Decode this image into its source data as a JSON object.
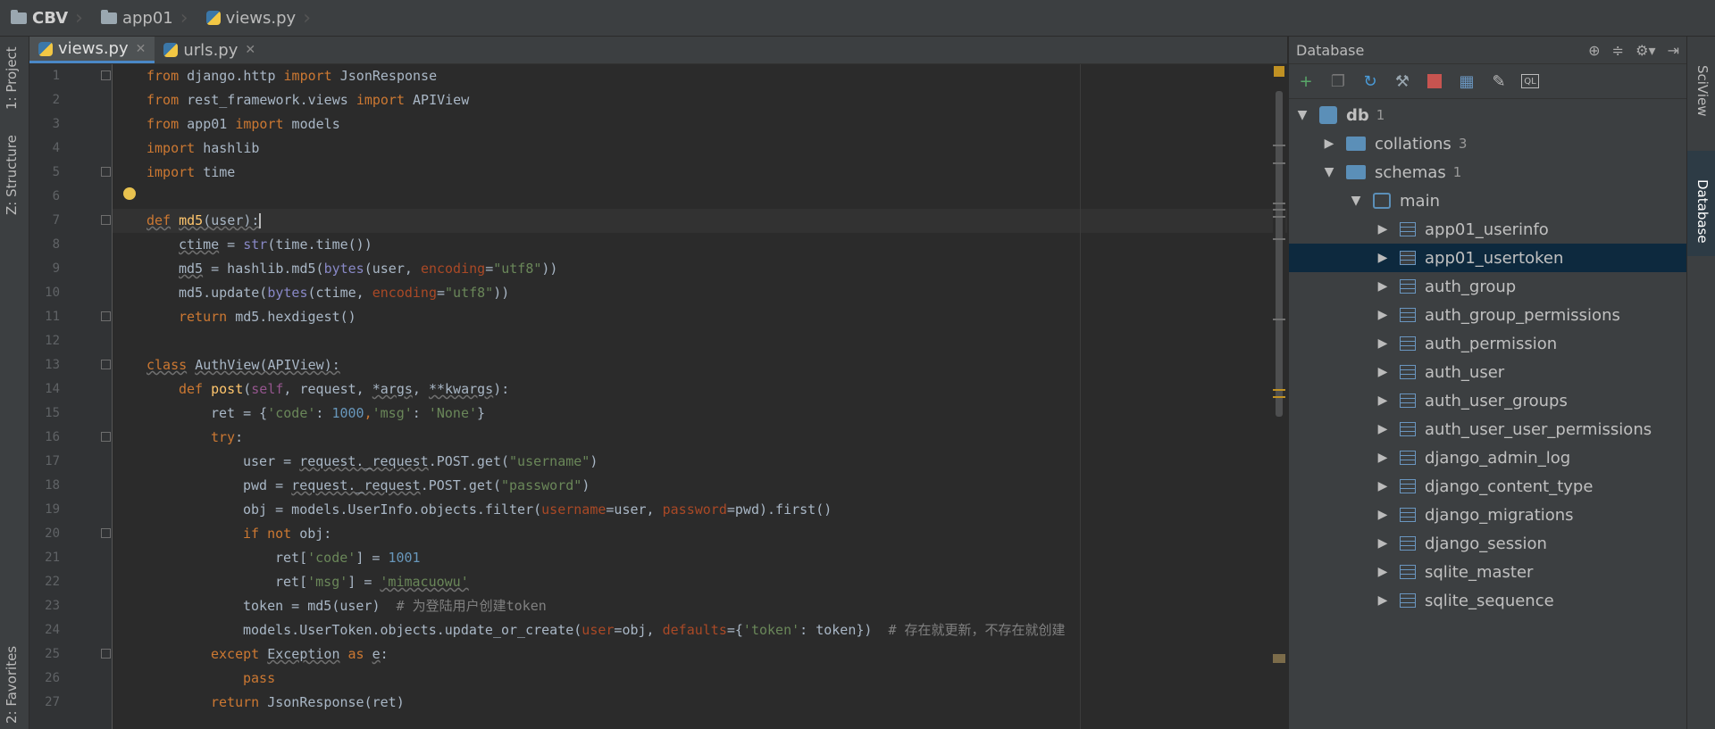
{
  "breadcrumb": {
    "items": [
      "CBV",
      "app01",
      "views.py"
    ]
  },
  "left_tool_tabs": [
    "1: Project",
    "Z: Structure",
    "2: Favorites"
  ],
  "right_tool_tabs": [
    "SciView",
    "Database"
  ],
  "editor_tabs": [
    {
      "label": "views.py",
      "active": true
    },
    {
      "label": "urls.py",
      "active": false
    }
  ],
  "line_numbers": [
    "1",
    "2",
    "3",
    "4",
    "5",
    "6",
    "7",
    "8",
    "9",
    "10",
    "11",
    "12",
    "13",
    "14",
    "15",
    "16",
    "17",
    "18",
    "19",
    "20",
    "21",
    "22",
    "23",
    "24",
    "25",
    "26",
    "27"
  ],
  "code": {
    "l1": [
      "from",
      " django.http ",
      "import",
      " JsonResponse"
    ],
    "l2": [
      "from",
      " rest_framework.views ",
      "import",
      " APIView"
    ],
    "l3": [
      "from",
      " app01 ",
      "import",
      " models"
    ],
    "l4": [
      "import",
      " hashlib"
    ],
    "l5": [
      "import",
      " time"
    ],
    "l7": [
      "def",
      " ",
      "md5",
      "(",
      "user",
      "):"
    ],
    "l8": [
      "ctime",
      " = ",
      "str",
      "(time.time())"
    ],
    "l9": [
      "md5",
      " = hashlib.md5(",
      "bytes",
      "(user, ",
      "encoding",
      "=",
      "\"utf8\"",
      "))"
    ],
    "l10": [
      "md5.update(",
      "bytes",
      "(ctime, ",
      "encoding",
      "=",
      "\"utf8\"",
      "))"
    ],
    "l11": [
      "return",
      " md5.hexdigest()"
    ],
    "l13": [
      "class",
      " ",
      "AuthView",
      "(",
      "APIView",
      "):"
    ],
    "l14": [
      "def",
      " ",
      "post",
      "(",
      "self",
      ", request, ",
      "*args",
      ", ",
      "**kwargs",
      "):"
    ],
    "l15": [
      "ret = {",
      "'code'",
      ": ",
      "1000",
      ",",
      "'msg'",
      ": ",
      "'None'",
      "}"
    ],
    "l16": [
      "try",
      ":"
    ],
    "l17": [
      "user = ",
      "request._request",
      ".POST.get(",
      "\"username\"",
      ")"
    ],
    "l18": [
      "pwd = ",
      "request._request",
      ".POST.get(",
      "\"password\"",
      ")"
    ],
    "l19": [
      "obj = models.UserInfo.objects.filter(",
      "username",
      "=user, ",
      "password",
      "=pwd).first()"
    ],
    "l20": [
      "if not",
      " obj:"
    ],
    "l21": [
      "ret[",
      "'code'",
      "] = ",
      "1001"
    ],
    "l22": [
      "ret[",
      "'msg'",
      "] = ",
      "'mimacuowu'"
    ],
    "l23": [
      "token = md5(user)  ",
      "# 为登陆用户创建token"
    ],
    "l24": [
      "models.UserToken.objects.update_or_create(",
      "user",
      "=obj, ",
      "defaults",
      "={",
      "'token'",
      ": token})  ",
      "# 存在就更新，不存在就创建"
    ],
    "l25": [
      "except",
      " ",
      "Exception",
      " ",
      "as",
      " ",
      "e",
      ":"
    ],
    "l26": [
      "pass"
    ],
    "l27": [
      "return",
      " JsonResponse(ret)"
    ]
  },
  "database_panel": {
    "title": "Database",
    "toolbar_icons": [
      "add-icon",
      "copy-icon",
      "refresh-icon",
      "properties-icon",
      "stop-icon",
      "table-icon",
      "edit-icon",
      "console-icon"
    ],
    "db": {
      "name": "db",
      "count": "1"
    },
    "collations": {
      "name": "collations",
      "count": "3"
    },
    "schemas": {
      "name": "schemas",
      "count": "1"
    },
    "schema_main": "main",
    "tables": [
      "app01_userinfo",
      "app01_usertoken",
      "auth_group",
      "auth_group_permissions",
      "auth_permission",
      "auth_user",
      "auth_user_groups",
      "auth_user_user_permissions",
      "django_admin_log",
      "django_content_type",
      "django_migrations",
      "django_session",
      "sqlite_master",
      "sqlite_sequence"
    ],
    "selected_table": "app01_usertoken"
  },
  "colors": {
    "keyword": "#cc7832",
    "string": "#6a8759",
    "number": "#6897bb",
    "comment": "#808080",
    "function": "#ffc66d",
    "builtin": "#8888c6",
    "selection": "#0d293e"
  }
}
